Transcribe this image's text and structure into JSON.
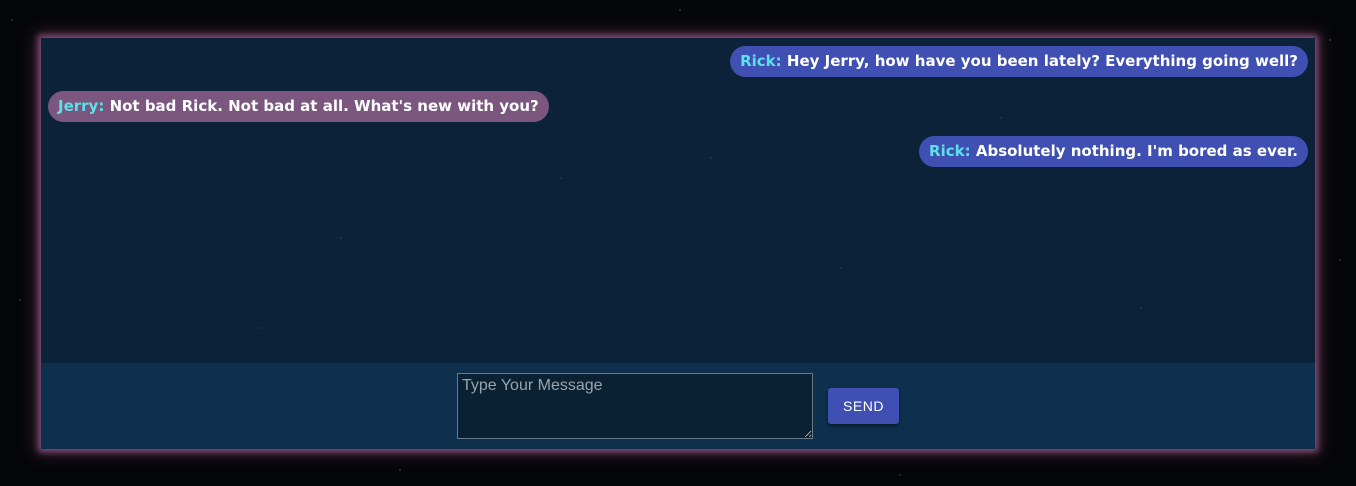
{
  "conversation": {
    "messages": [
      {
        "sender": "Rick:",
        "text": "Hey Jerry, how have you been lately? Everything going well?",
        "side": "right"
      },
      {
        "sender": "Jerry:",
        "text": "Not bad Rick. Not bad at all. What's new with you?",
        "side": "left"
      },
      {
        "sender": "Rick:",
        "text": "Absolutely nothing. I'm bored as ever.",
        "side": "right"
      }
    ]
  },
  "composer": {
    "placeholder": "Type Your Message",
    "value": "",
    "send_label": "SEND"
  },
  "colors": {
    "rick_bubble": "#3f4fb2",
    "jerry_bubble": "#7b577f",
    "sender_name": "#5ee0ea",
    "chat_background": "#0c2238",
    "input_bar": "#0e304d",
    "frame_glow": "#a05f8c"
  }
}
